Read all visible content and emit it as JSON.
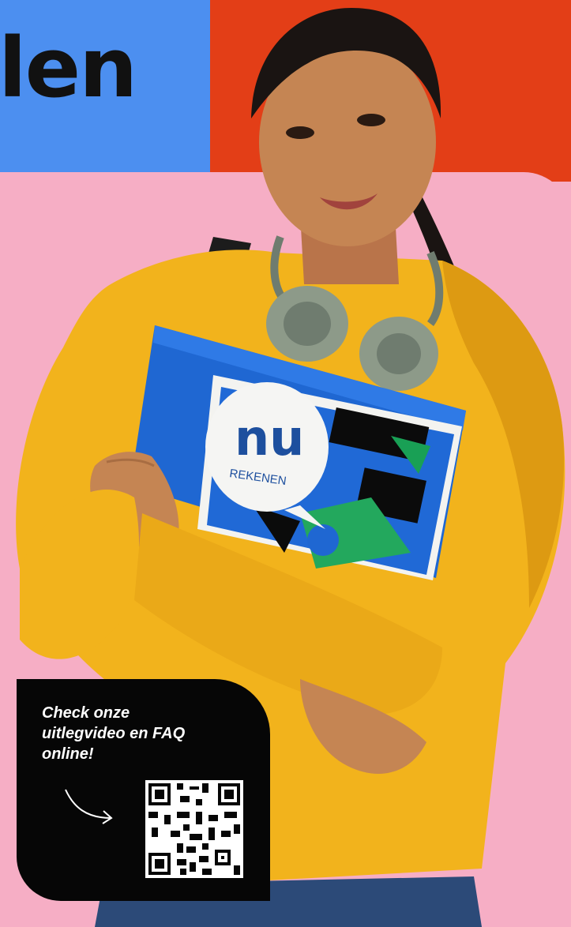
{
  "header": {
    "headline_fragment": "len"
  },
  "book": {
    "brand_mark": "nu",
    "brand_name": "REKENEN"
  },
  "qr_card": {
    "text": "Check onze uitlegvideo en FAQ online!"
  },
  "colors": {
    "blue_block": "#4c8ff0",
    "red_block": "#e33e17",
    "pink_background": "#f6aec5",
    "card_black": "#060606",
    "sweater_yellow": "#f2b31c",
    "book_blue": "#1f67d2"
  },
  "icons": {
    "arrow": "curved-arrow-icon",
    "qr": "qr-code-icon"
  }
}
